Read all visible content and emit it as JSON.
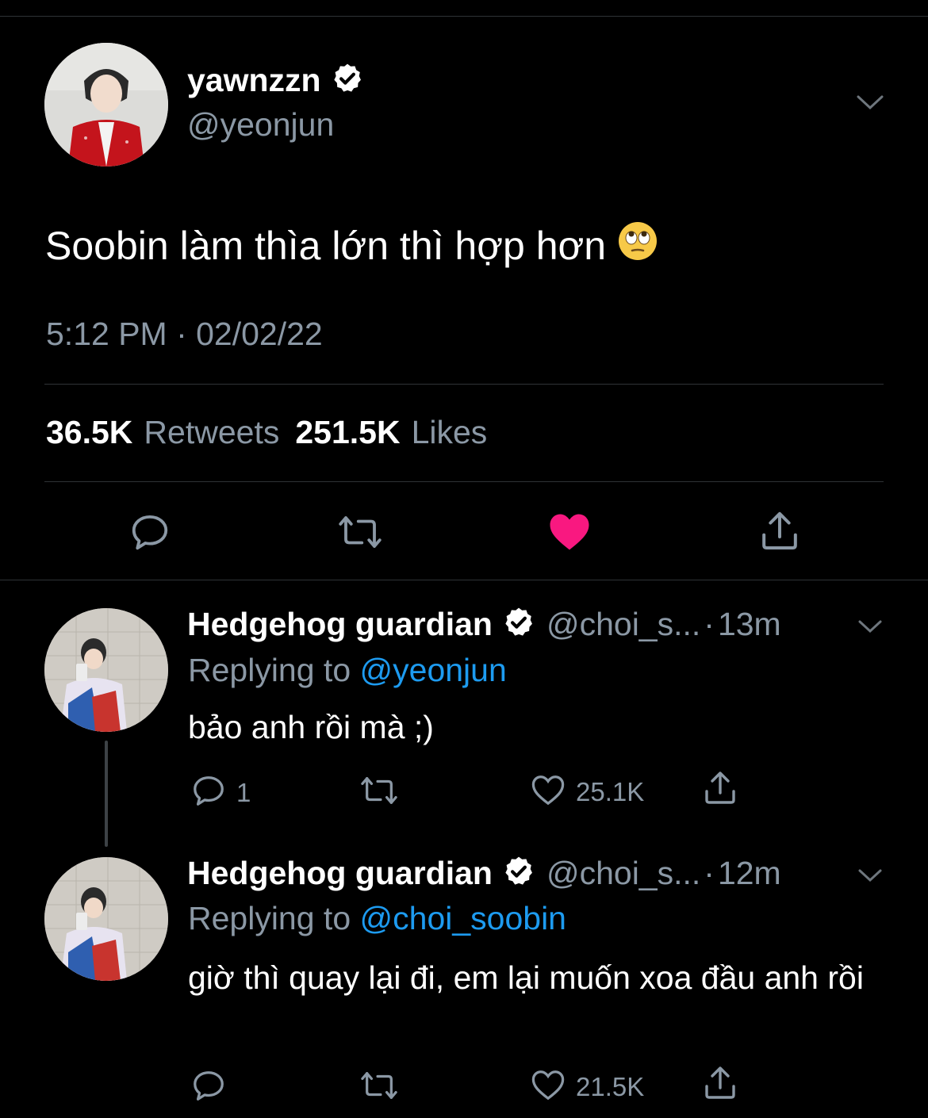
{
  "main_tweet": {
    "display_name": "yawnzzn",
    "handle": "@yeonjun",
    "text": "Soobin làm thìa lớn thì hợp hơn",
    "emoji": "face-with-rolling-eyes",
    "timestamp": "5:12 PM · 02/02/22",
    "retweets_count": "36.5K",
    "retweets_label": "Retweets",
    "likes_count": "251.5K",
    "likes_label": "Likes",
    "liked": true
  },
  "replies": [
    {
      "display_name": "Hedgehog guardian",
      "handle": "@choi_s...",
      "separator": "·",
      "time": "13m",
      "replying_prefix": "Replying to",
      "replying_to": "@yeonjun",
      "text": "bảo anh rồi mà ;)",
      "reply_count": "1",
      "retweet_count": "",
      "like_count": "25.1K"
    },
    {
      "display_name": "Hedgehog guardian",
      "handle": "@choi_s...",
      "separator": "·",
      "time": "12m",
      "replying_prefix": "Replying to",
      "replying_to": "@choi_soobin",
      "text": "giờ thì quay lại đi, em lại muốn xoa đầu anh rồi",
      "reply_count": "",
      "retweet_count": "",
      "like_count": "21.5K"
    }
  ],
  "colors": {
    "background": "#000000",
    "secondary_text": "#8b98a5",
    "link": "#1d9bf0",
    "like_active": "#f91880",
    "divider": "#2f3336"
  }
}
